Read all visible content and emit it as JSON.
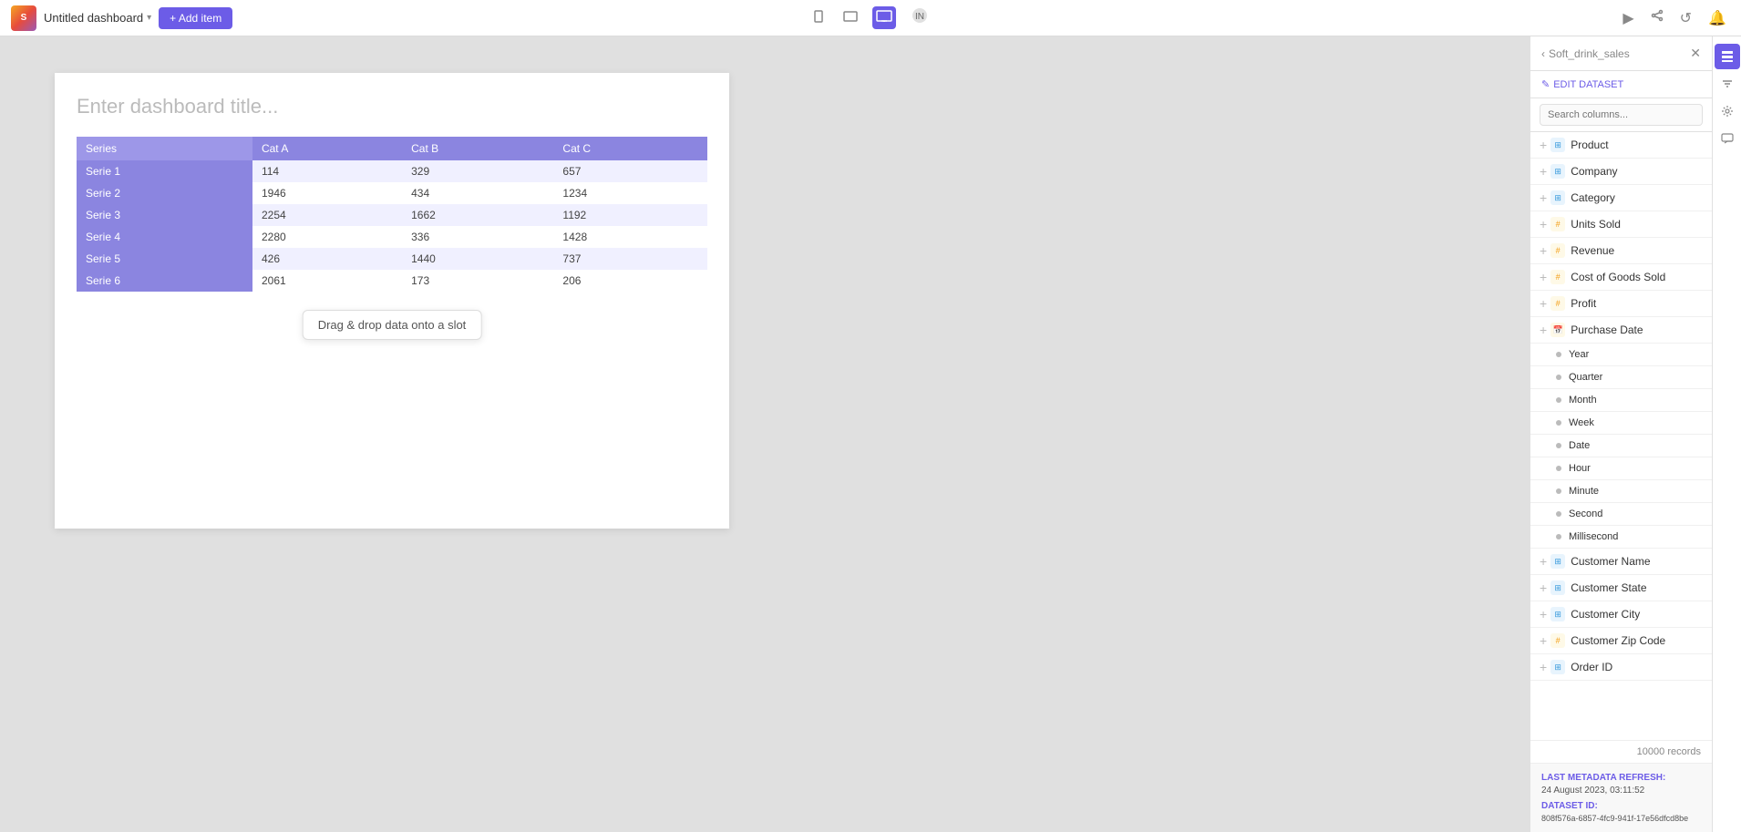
{
  "topbar": {
    "logo_text": "S",
    "dashboard_title": "Untitled dashboard",
    "add_item_label": "+ Add item",
    "view_modes": [
      "mobile",
      "tablet",
      "desktop"
    ],
    "active_view": "desktop"
  },
  "canvas": {
    "title_placeholder": "Enter dashboard title...",
    "drag_drop_text": "Drag & drop data onto a slot",
    "table": {
      "headers": [
        "Series",
        "Cat A",
        "Cat B",
        "Cat C"
      ],
      "rows": [
        [
          "Serie 1",
          "114",
          "329",
          "657"
        ],
        [
          "Serie 2",
          "1946",
          "434",
          "1234"
        ],
        [
          "Serie 3",
          "2254",
          "1662",
          "1192"
        ],
        [
          "Serie 4",
          "2280",
          "336",
          "1428"
        ],
        [
          "Serie 5",
          "426",
          "1440",
          "737"
        ],
        [
          "Serie 6",
          "2061",
          "173",
          "206"
        ]
      ]
    }
  },
  "right_panel": {
    "dataset_name": "Soft_drink_sales",
    "edit_dataset_label": "EDIT DATASET",
    "search_placeholder": "Search columns...",
    "columns": [
      {
        "name": "Product",
        "type": "text",
        "expandable": true
      },
      {
        "name": "Company",
        "type": "text",
        "expandable": true
      },
      {
        "name": "Category",
        "type": "text",
        "expandable": true
      },
      {
        "name": "Units Sold",
        "type": "numeric",
        "expandable": true
      },
      {
        "name": "Revenue",
        "type": "numeric",
        "expandable": true
      },
      {
        "name": "Cost of Goods Sold",
        "type": "numeric",
        "expandable": true
      },
      {
        "name": "Profit",
        "type": "numeric",
        "expandable": true
      },
      {
        "name": "Purchase Date",
        "type": "date",
        "expandable": true
      },
      {
        "name": "Year",
        "type": "sub",
        "parent": "Purchase Date"
      },
      {
        "name": "Quarter",
        "type": "sub",
        "parent": "Purchase Date"
      },
      {
        "name": "Month",
        "type": "sub",
        "parent": "Purchase Date"
      },
      {
        "name": "Week",
        "type": "sub",
        "parent": "Purchase Date"
      },
      {
        "name": "Date",
        "type": "sub",
        "parent": "Purchase Date"
      },
      {
        "name": "Hour",
        "type": "sub",
        "parent": "Purchase Date"
      },
      {
        "name": "Minute",
        "type": "sub",
        "parent": "Purchase Date"
      },
      {
        "name": "Second",
        "type": "sub",
        "parent": "Purchase Date"
      },
      {
        "name": "Millisecond",
        "type": "sub",
        "parent": "Purchase Date"
      },
      {
        "name": "Customer Name",
        "type": "text",
        "expandable": true
      },
      {
        "name": "Customer State",
        "type": "text",
        "expandable": true
      },
      {
        "name": "Customer City",
        "type": "text",
        "expandable": true
      },
      {
        "name": "Customer Zip Code",
        "type": "numeric",
        "expandable": true
      },
      {
        "name": "Order ID",
        "type": "text",
        "expandable": true
      }
    ],
    "records_count": "10000 records",
    "metadata": {
      "last_refresh_label": "LAST METADATA REFRESH:",
      "last_refresh_value": "24 August 2023, 03:11:52",
      "dataset_id_label": "DATASET ID:",
      "dataset_id_value": "808f576a-6857-4fc9-941f-17e56dfcd8be"
    }
  },
  "side_tabs": [
    "Data",
    "Filters",
    "Settings",
    "Comments"
  ]
}
